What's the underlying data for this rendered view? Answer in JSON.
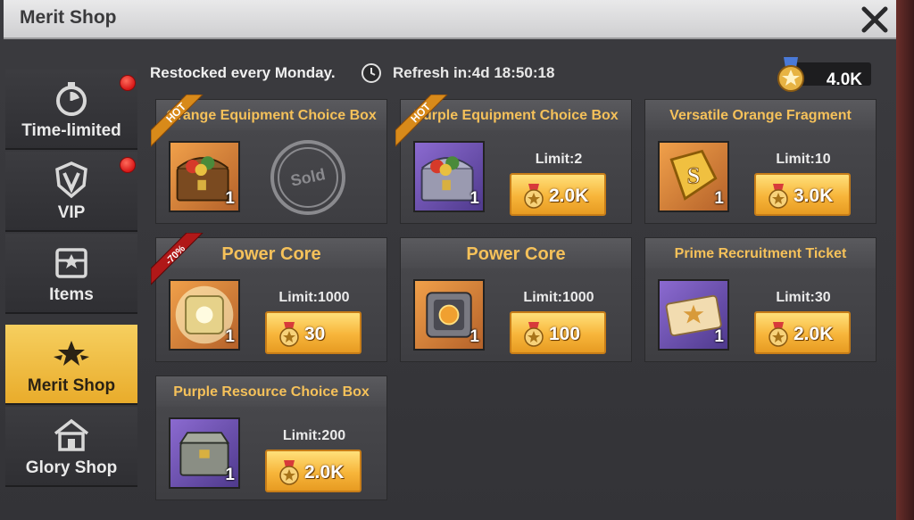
{
  "window": {
    "title": "Merit Shop"
  },
  "sidebar": {
    "items": [
      {
        "label": "Time-limited",
        "icon": "stopwatch-icon",
        "has_badge": true
      },
      {
        "label": "VIP",
        "icon": "vip-shield-icon",
        "has_badge": true
      },
      {
        "label": "Items",
        "icon": "chest-icon",
        "has_badge": false
      },
      {
        "label": "Merit Shop",
        "icon": "star-wings-icon",
        "active": true
      },
      {
        "label": "Glory Shop",
        "icon": "shop-building-icon",
        "has_badge": false
      }
    ]
  },
  "header": {
    "restock_text": "Restocked every Monday.",
    "refresh_text": "Refresh in:4d 18:50:18",
    "currency_amount": "4.0K"
  },
  "items": [
    {
      "name": "Orange Equipment Choice Box",
      "qty": "1",
      "tag": "HOT",
      "sold": true,
      "sold_label": "Sold",
      "bg": "orange",
      "icon": "treasure-chest-icon"
    },
    {
      "name": "Purple Equipment Choice Box",
      "qty": "1",
      "tag": "HOT",
      "limit": "Limit:2",
      "price": "2.0K",
      "bg": "purple",
      "icon": "treasure-chest-icon"
    },
    {
      "name": "Versatile Orange Fragment",
      "qty": "1",
      "limit": "Limit:10",
      "price": "3.0K",
      "bg": "orange",
      "icon": "puzzle-fragment-icon"
    },
    {
      "name": "Power Core",
      "qty": "1",
      "tag": "-70%",
      "limit": "Limit:1000",
      "price": "30",
      "bg": "orange",
      "icon": "power-core-icon"
    },
    {
      "name": "Power Core",
      "qty": "1",
      "limit": "Limit:1000",
      "price": "100",
      "bg": "orange",
      "icon": "power-core-icon"
    },
    {
      "name": "Prime Recruitment Ticket",
      "qty": "1",
      "limit": "Limit:30",
      "price": "2.0K",
      "bg": "purple",
      "icon": "ticket-icon"
    },
    {
      "name": "Purple Resource Choice Box",
      "qty": "1",
      "limit": "Limit:200",
      "price": "2.0K",
      "bg": "purple",
      "icon": "resource-crate-icon"
    }
  ],
  "colors": {
    "accent_gold": "#f5c15a",
    "active_tab": "#f0c04a",
    "badge_red": "#d71818",
    "hot_ribbon": "#d88a1a",
    "discount_ribbon": "#b01818"
  }
}
